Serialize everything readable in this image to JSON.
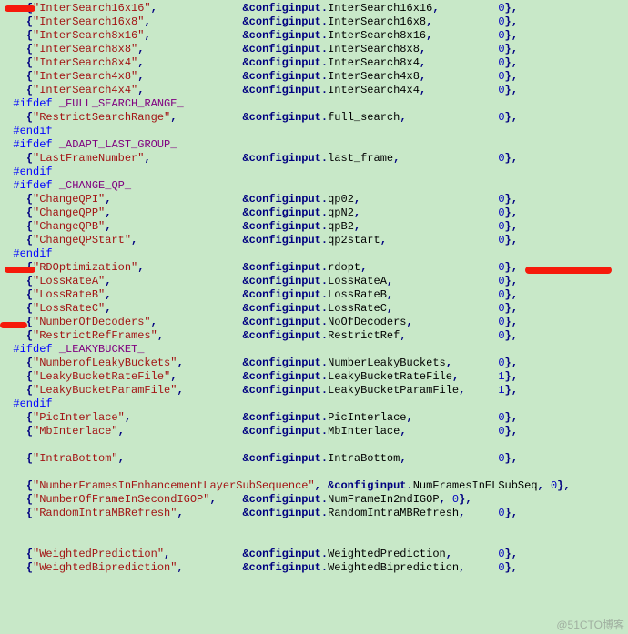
{
  "watermark": "@51CTO博客",
  "lines": [
    {
      "type": "entry",
      "key": "InterSearch16x16",
      "field": "InterSearch16x16",
      "val": "0",
      "indent": 4,
      "col2": 28
    },
    {
      "type": "entry",
      "key": "InterSearch16x8",
      "field": "InterSearch16x8",
      "val": "0",
      "indent": 4,
      "col2": 28
    },
    {
      "type": "entry",
      "key": "InterSearch8x16",
      "field": "InterSearch8x16",
      "val": "0",
      "indent": 4,
      "col2": 28
    },
    {
      "type": "entry",
      "key": "InterSearch8x8",
      "field": "InterSearch8x8",
      "val": "0",
      "indent": 4,
      "col2": 28
    },
    {
      "type": "entry",
      "key": "InterSearch8x4",
      "field": "InterSearch8x4",
      "val": "0",
      "indent": 4,
      "col2": 28
    },
    {
      "type": "entry",
      "key": "InterSearch4x8",
      "field": "InterSearch4x8",
      "val": "0",
      "indent": 4,
      "col2": 28
    },
    {
      "type": "entry",
      "key": "InterSearch4x4",
      "field": "InterSearch4x4",
      "val": "0",
      "indent": 4,
      "col2": 28
    },
    {
      "type": "pp",
      "kw": "#ifdef",
      "macro": "_FULL_SEARCH_RANGE_"
    },
    {
      "type": "entry",
      "key": "RestrictSearchRange",
      "field": "full_search",
      "val": "0",
      "indent": 4,
      "col2": 28
    },
    {
      "type": "pp",
      "kw": "#endif",
      "macro": ""
    },
    {
      "type": "pp",
      "kw": "#ifdef",
      "macro": "_ADAPT_LAST_GROUP_"
    },
    {
      "type": "entry",
      "key": "LastFrameNumber",
      "field": "last_frame",
      "val": "0",
      "indent": 4,
      "col2": 28
    },
    {
      "type": "pp",
      "kw": "#endif",
      "macro": ""
    },
    {
      "type": "pp",
      "kw": "#ifdef",
      "macro": "_CHANGE_QP_"
    },
    {
      "type": "entry",
      "key": "ChangeQPI",
      "field": "qp02",
      "val": "0",
      "indent": 4,
      "col2": 28
    },
    {
      "type": "entry",
      "key": "ChangeQPP",
      "field": "qpN2",
      "val": "0",
      "indent": 4,
      "col2": 28
    },
    {
      "type": "entry",
      "key": "ChangeQPB",
      "field": "qpB2",
      "val": "0",
      "indent": 4,
      "col2": 28
    },
    {
      "type": "entry",
      "key": "ChangeQPStart",
      "field": "qp2start",
      "val": "0",
      "indent": 4,
      "col2": 28
    },
    {
      "type": "pp",
      "kw": "#endif",
      "macro": ""
    },
    {
      "type": "entry",
      "key": "RDOptimization",
      "field": "rdopt",
      "val": "0",
      "indent": 4,
      "col2": 28,
      "emph": true
    },
    {
      "type": "entry",
      "key": "LossRateA",
      "field": "LossRateA",
      "val": "0",
      "indent": 4,
      "col2": 28
    },
    {
      "type": "entry",
      "key": "LossRateB",
      "field": "LossRateB",
      "val": "0",
      "indent": 4,
      "col2": 28
    },
    {
      "type": "entry",
      "key": "LossRateC",
      "field": "LossRateC",
      "val": "0",
      "indent": 4,
      "col2": 28
    },
    {
      "type": "entry",
      "key": "NumberOfDecoders",
      "field": "NoOfDecoders",
      "val": "0",
      "indent": 4,
      "col2": 28
    },
    {
      "type": "entry",
      "key": "RestrictRefFrames",
      "field": "RestrictRef",
      "val": "0",
      "indent": 4,
      "col2": 28
    },
    {
      "type": "pp",
      "kw": "#ifdef",
      "macro": "_LEAKYBUCKET_"
    },
    {
      "type": "entry",
      "key": "NumberofLeakyBuckets",
      "field": "NumberLeakyBuckets",
      "val": "0",
      "indent": 4,
      "col2": 28
    },
    {
      "type": "entry",
      "key": "LeakyBucketRateFile",
      "field": "LeakyBucketRateFile",
      "val": "1",
      "indent": 4,
      "col2": 28
    },
    {
      "type": "entry",
      "key": "LeakyBucketParamFile",
      "field": "LeakyBucketParamFile",
      "val": "1",
      "indent": 4,
      "col2": 28
    },
    {
      "type": "pp",
      "kw": "#endif",
      "macro": ""
    },
    {
      "type": "entry",
      "key": "PicInterlace",
      "field": "PicInterlace",
      "val": "0",
      "indent": 4,
      "col2": 28
    },
    {
      "type": "entry",
      "key": "MbInterlace",
      "field": "MbInterlace",
      "val": "0",
      "indent": 4,
      "col2": 28
    },
    {
      "type": "blank"
    },
    {
      "type": "entry",
      "key": "IntraBottom",
      "field": "IntraBottom",
      "val": "0",
      "indent": 4,
      "col2": 28
    },
    {
      "type": "blank"
    },
    {
      "type": "tight",
      "key": "NumberFramesInEnhancementLayerSubSequence",
      "field": "NumFramesInELSubSeq",
      "val": "0",
      "indent": 4
    },
    {
      "type": "tight",
      "key": "NumberOfFrameInSecondIGOP",
      "field": "NumFrameIn2ndIGOP",
      "val": "0",
      "indent": 4,
      "col2": 28
    },
    {
      "type": "entry",
      "key": "RandomIntraMBRefresh",
      "field": "RandomIntraMBRefresh",
      "val": "0",
      "indent": 4,
      "col2": 28
    },
    {
      "type": "blank"
    },
    {
      "type": "blank"
    },
    {
      "type": "entry",
      "key": "WeightedPrediction",
      "field": "WeightedPrediction",
      "val": "0",
      "indent": 4,
      "col2": 28
    },
    {
      "type": "entry",
      "key": "WeightedBiprediction",
      "field": "WeightedBiprediction",
      "val": "0",
      "indent": 4,
      "col2": 28
    }
  ]
}
